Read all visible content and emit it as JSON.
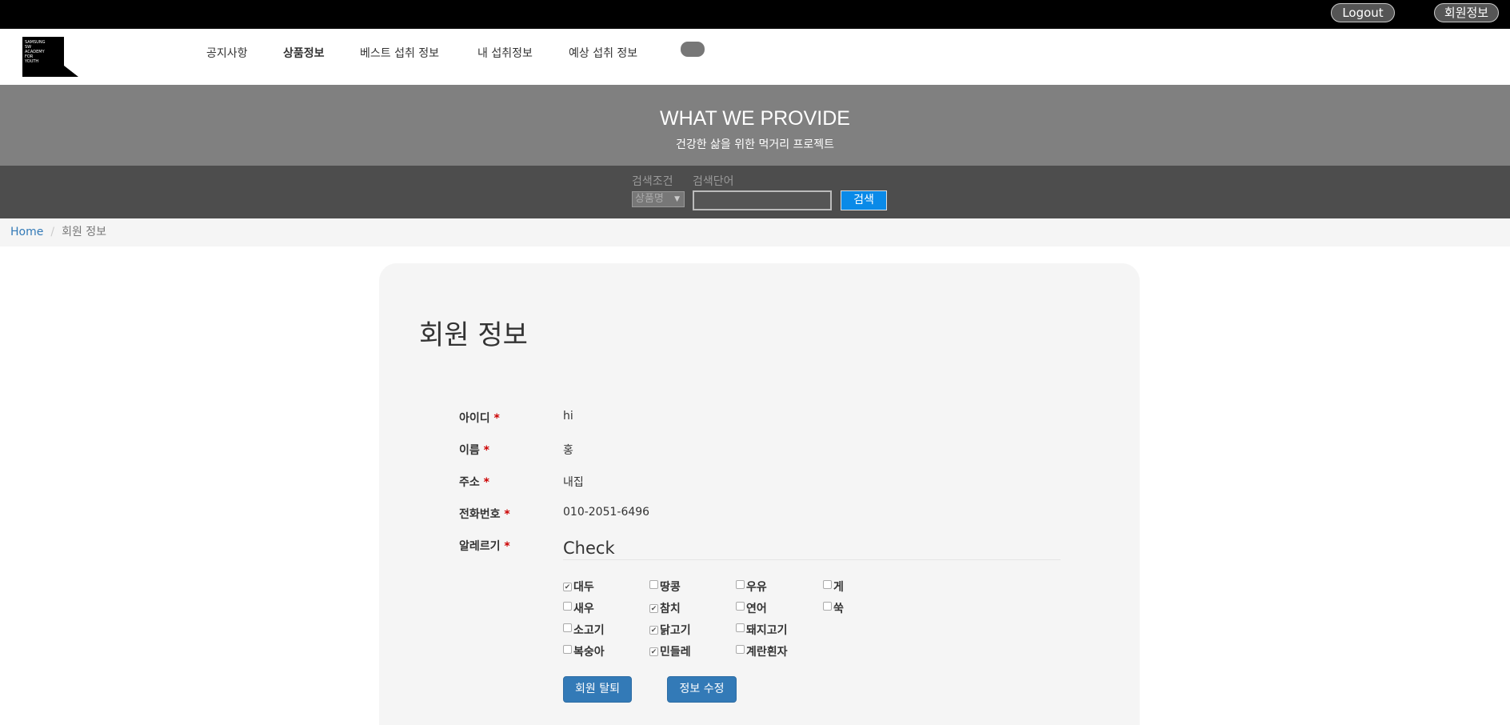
{
  "topbar": {
    "logout_label": "Logout",
    "member_label": "회원정보"
  },
  "logo": {
    "lines": [
      "SAMSUNG",
      "SW",
      "ACADEMY",
      "FOR",
      "YOUTH"
    ]
  },
  "nav": {
    "items": [
      "공지사항",
      "상품정보",
      "베스트 섭취 정보",
      "내 섭취정보",
      "예상 섭취 정보"
    ]
  },
  "hero": {
    "title": "WHAT WE PROVIDE",
    "subtitle": "건강한 삶을 위한 먹거리 프로젝트"
  },
  "search": {
    "condition_label": "검색조건",
    "keyword_label": "검색단어",
    "selected_condition": "상품명",
    "keyword_value": "",
    "button_label": "검색"
  },
  "breadcrumb": {
    "home": "Home",
    "separator": "/",
    "current": "회원 정보"
  },
  "page": {
    "title": "회원 정보"
  },
  "fields": [
    {
      "label": "아이디",
      "value": "hi"
    },
    {
      "label": "이름",
      "value": "홍"
    },
    {
      "label": "주소",
      "value": "내집"
    },
    {
      "label": "전화번호",
      "value": "010-2051-6496"
    }
  ],
  "allergy": {
    "label": "알레르기",
    "legend": "Check",
    "required_mark": "*",
    "options": [
      {
        "label": "대두",
        "checked": true
      },
      {
        "label": "땅콩",
        "checked": false
      },
      {
        "label": "우유",
        "checked": false
      },
      {
        "label": "게",
        "checked": false
      },
      {
        "label": "새우",
        "checked": false
      },
      {
        "label": "참치",
        "checked": true
      },
      {
        "label": "연어",
        "checked": false
      },
      {
        "label": "쑥",
        "checked": false
      },
      {
        "label": "소고기",
        "checked": false
      },
      {
        "label": "닭고기",
        "checked": true
      },
      {
        "label": "돼지고기",
        "checked": false
      },
      {
        "label": "복숭아",
        "checked": false
      },
      {
        "label": "민들레",
        "checked": true
      },
      {
        "label": "계란흰자",
        "checked": false
      }
    ]
  },
  "actions": {
    "withdraw_label": "회원 탈퇴",
    "edit_label": "정보 수정"
  },
  "colors": {
    "primary": "#337ab7",
    "search_button": "#0a8ae8",
    "required": "#cc0000"
  }
}
